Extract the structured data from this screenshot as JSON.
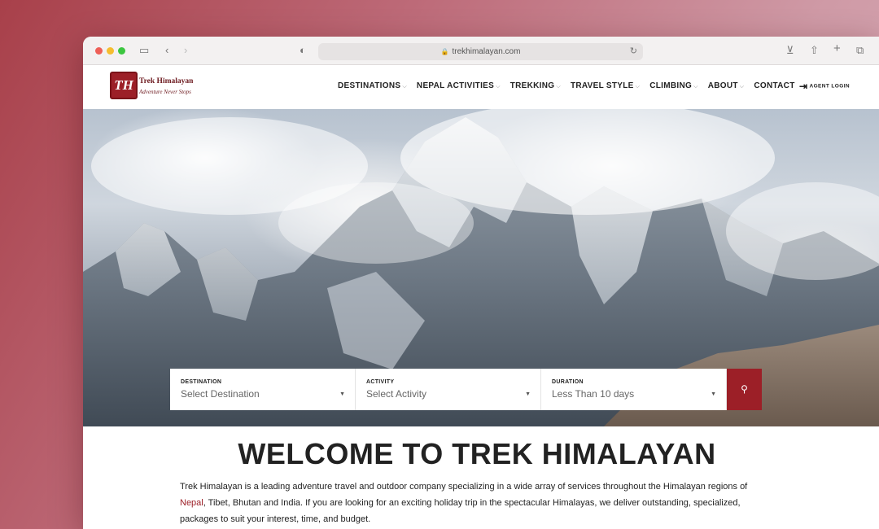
{
  "browser": {
    "url": "trekhimalayan.com"
  },
  "site": {
    "logo_name": "Trek Himalayan",
    "logo_tagline": "Adventure Never Stops",
    "logo_mark": "TH",
    "nav": [
      {
        "label": "DESTINATIONS",
        "has_dropdown": true
      },
      {
        "label": "NEPAL ACTIVITIES",
        "has_dropdown": true
      },
      {
        "label": "TREKKING",
        "has_dropdown": true
      },
      {
        "label": "TRAVEL STYLE",
        "has_dropdown": true
      },
      {
        "label": "CLIMBING",
        "has_dropdown": true
      },
      {
        "label": "ABOUT",
        "has_dropdown": true
      },
      {
        "label": "CONTACT",
        "has_dropdown": false
      }
    ],
    "agent_login": "AGENT LOGIN"
  },
  "search": {
    "destination": {
      "label": "DESTINATION",
      "value": "Select Destination"
    },
    "activity": {
      "label": "ACTIVITY",
      "value": "Select Activity"
    },
    "duration": {
      "label": "DURATION",
      "value": "Less Than 10 days"
    }
  },
  "content": {
    "heading": "WELCOME TO TREK HIMALAYAN",
    "intro_before": "Trek Himalayan is a leading adventure travel and outdoor company specializing in a wide array of services throughout the Himalayan regions of ",
    "intro_link": "Nepal",
    "intro_after": ", Tibet, Bhutan and India. If you are looking for an exciting holiday trip in the spectacular Himalayas, we deliver outstanding, specialized, packages to suit your interest, time, and budget."
  },
  "colors": {
    "brand": "#9c1f27",
    "background_gradient_start": "#a8404a",
    "background_gradient_end": "#d9b0bb"
  }
}
